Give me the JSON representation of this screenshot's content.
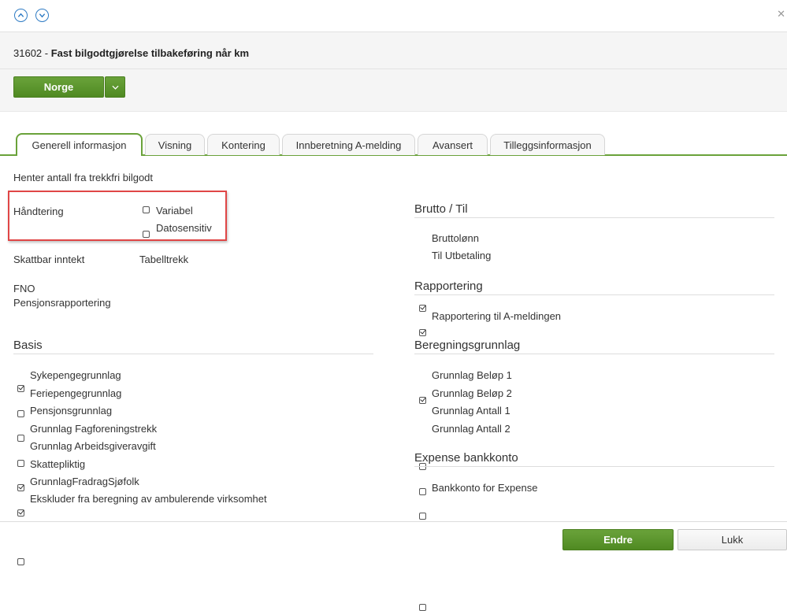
{
  "header": {
    "record_number": "31602",
    "separator": " - ",
    "record_name": "Fast bilgodtgjørelse tilbakeføring når km"
  },
  "toolbar": {
    "country_label": "Norge"
  },
  "tabs": [
    {
      "label": "Generell informasjon",
      "active": true
    },
    {
      "label": "Visning"
    },
    {
      "label": "Kontering"
    },
    {
      "label": "Innberetning A-melding"
    },
    {
      "label": "Avansert"
    },
    {
      "label": "Tilleggsinformasjon"
    }
  ],
  "general": {
    "source_text": "Henter antall fra trekkfri bilgodt",
    "handling_label": "Håndtering",
    "handling_options": [
      {
        "label": "Variabel",
        "checked": false
      },
      {
        "label": "Datosensitiv",
        "checked": false
      }
    ],
    "taxable_label": "Skattbar inntekt",
    "taxable_value": "Tabelltrekk",
    "fno_label": "FNO",
    "pension_label": "Pensjonsrapportering"
  },
  "basis": {
    "title": "Basis",
    "items": [
      {
        "label": "Sykepengegrunnlag",
        "checked": true
      },
      {
        "label": "Feriepengegrunnlag",
        "checked": false
      },
      {
        "label": "Pensjonsgrunnlag",
        "checked": false
      },
      {
        "label": "Grunnlag Fagforeningstrekk",
        "checked": false
      },
      {
        "label": "Grunnlag Arbeidsgiveravgift",
        "checked": true
      },
      {
        "label": "Skattepliktig",
        "checked": true
      },
      {
        "label": "GrunnlagFradragSjøfolk",
        "checked": false
      },
      {
        "label": "Ekskluder fra beregning av ambulerende virksomhet",
        "checked": false
      }
    ]
  },
  "brutto": {
    "title": "Brutto / Til",
    "items": [
      {
        "label": "Bruttolønn",
        "checked": true
      },
      {
        "label": "Til Utbetaling",
        "checked": true
      }
    ]
  },
  "reporting": {
    "title": "Rapportering",
    "items": [
      {
        "label": "Rapportering til A-meldingen",
        "checked": true
      }
    ]
  },
  "calc_basis": {
    "title": "Beregningsgrunnlag",
    "items": [
      {
        "label": "Grunnlag Beløp 1",
        "checked": false
      },
      {
        "label": "Grunnlag Beløp 2",
        "checked": false
      },
      {
        "label": "Grunnlag Antall 1",
        "checked": false
      },
      {
        "label": "Grunnlag Antall 2",
        "checked": false
      }
    ]
  },
  "expense": {
    "title": "Expense bankkonto",
    "items": [
      {
        "label": "Bankkonto for Expense",
        "checked": false
      }
    ]
  },
  "footer": {
    "edit_label": "Endre",
    "close_label": "Lukk"
  },
  "colors": {
    "accent_green": "#6aa23a",
    "nav_blue": "#2e7bc4",
    "highlight_red": "#e04646"
  },
  "icons": [
    "chevron-up-icon",
    "chevron-down-icon",
    "close-icon",
    "dropdown-chevron-icon",
    "checkbox-icon"
  ]
}
